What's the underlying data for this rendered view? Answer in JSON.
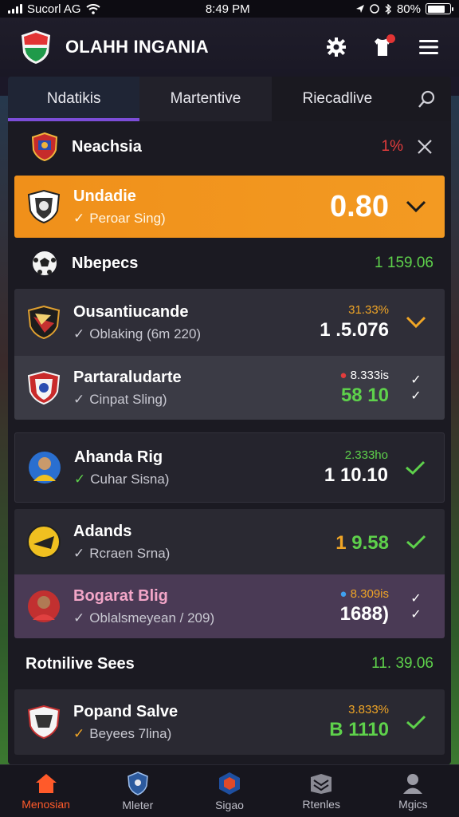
{
  "status_bar": {
    "carrier": "Sucorl AG",
    "time": "8:49 PM",
    "battery": "80%"
  },
  "header": {
    "title": "OLAHH INGANIA"
  },
  "tabs": [
    {
      "label": "Ndatikis"
    },
    {
      "label": "Martentive"
    },
    {
      "label": "Riecadlive"
    }
  ],
  "sections": {
    "s1": {
      "label": "Neachsia",
      "value": "1%"
    },
    "s2": {
      "label": "Nbepecs",
      "value": "1 159.06"
    },
    "s3": {
      "label": "Rotnilive Sees",
      "value": "11. 39.06"
    }
  },
  "cards": {
    "c1": {
      "name": "Undadie",
      "sub": "Peroar Sing)",
      "value": "0.80"
    },
    "c2": {
      "name": "Ousantiucande",
      "sub": "Oblaking (6m 220)",
      "small": "31.33%",
      "big": "1 .5.076"
    },
    "c3": {
      "name": "Partaraludarte",
      "sub": "Cinpat Sling)",
      "small": "8.333is",
      "big": "58 10"
    },
    "c4": {
      "name": "Ahanda Rig",
      "sub": "Cuhar Sisna)",
      "small": "2.333ho",
      "big": "1 10.10"
    },
    "c5": {
      "name": "Adands",
      "sub": "Rcraen Srna)",
      "big_prefix": "1",
      "big": "9.58"
    },
    "c6": {
      "name": "Bogarat Blig",
      "sub": "Oblalsmeyean / 209)",
      "small": "8.309is",
      "big": "1688)"
    },
    "c7": {
      "name": "Popand Salve",
      "sub": "Beyees 7lina)",
      "small": "3.833%",
      "big": "B  1110"
    }
  },
  "bottom_nav": [
    {
      "label": "Menosian",
      "icon": "home-icon"
    },
    {
      "label": "Mleter",
      "icon": "shield-icon"
    },
    {
      "label": "Sigao",
      "icon": "badge-icon"
    },
    {
      "label": "Rtenles",
      "icon": "stack-icon"
    },
    {
      "label": "Mgics",
      "icon": "user-icon"
    }
  ],
  "colors": {
    "accent": "#f0901a",
    "positive": "#5ed14b",
    "negative": "#e23c3c",
    "active_tab": "#7c4dd8"
  }
}
